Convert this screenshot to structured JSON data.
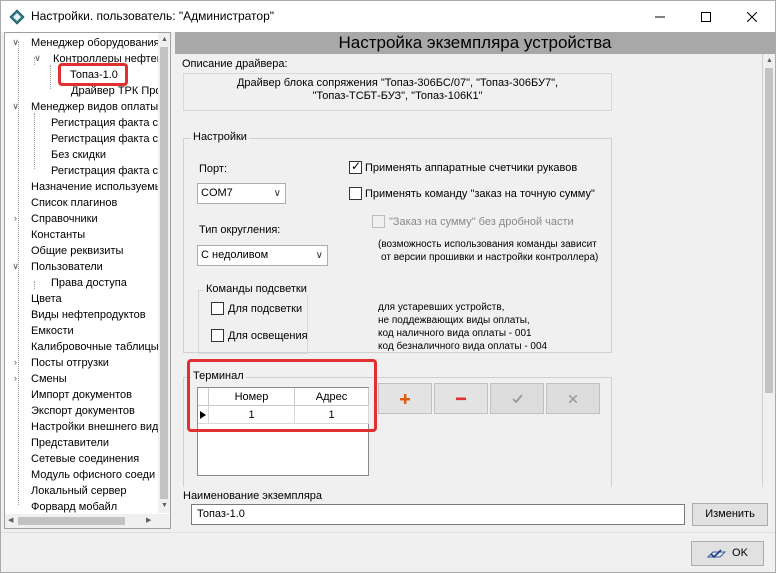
{
  "window": {
    "title": "Настройки. пользователь: \"Администратор\""
  },
  "tree": {
    "items": [
      {
        "label": "Менеджер оборудования"
      },
      {
        "label": "Контроллеры нефтеп"
      },
      {
        "label": "Топаз-1.0"
      },
      {
        "label": "Драйвер ТРК Про"
      },
      {
        "label": "Менеджер видов оплаты"
      },
      {
        "label": "Регистрация факта с"
      },
      {
        "label": "Регистрация факта с"
      },
      {
        "label": "Без скидки"
      },
      {
        "label": "Регистрация факта с"
      },
      {
        "label": "Назначение используемы"
      },
      {
        "label": "Список плагинов"
      },
      {
        "label": "Справочники"
      },
      {
        "label": "Константы"
      },
      {
        "label": "Общие реквизиты"
      },
      {
        "label": "Пользователи"
      },
      {
        "label": "Права доступа"
      },
      {
        "label": "Цвета"
      },
      {
        "label": "Виды нефтепродуктов"
      },
      {
        "label": "Емкости"
      },
      {
        "label": "Калибровочные таблицы"
      },
      {
        "label": "Посты отгрузки"
      },
      {
        "label": "Смены"
      },
      {
        "label": "Импорт документов"
      },
      {
        "label": "Экспорт документов"
      },
      {
        "label": "Настройки внешнего вид"
      },
      {
        "label": "Представители"
      },
      {
        "label": "Сетевые соединения"
      },
      {
        "label": "Модуль офисного соеди"
      },
      {
        "label": "Локальный сервер"
      },
      {
        "label": "Форвард мобайл"
      }
    ]
  },
  "main": {
    "header": "Настройка экземпляра устройства",
    "driver_desc_label": "Описание драйвера:",
    "driver_desc_line1": "Драйвер блока сопряжения \"Топаз-306БС/07\", \"Топаз-306БУ7\",",
    "driver_desc_line2": "\"Топаз-ТСБТ-БУЗ\", \"Топаз-106К1\"",
    "settings": {
      "title": "Настройки",
      "port_label": "Порт:",
      "port_value": "COM7",
      "rounding_label": "Тип округления:",
      "rounding_value": "С недоливом",
      "backlight_group": "Команды подсветки",
      "backlight_fill": "Для подсветки",
      "backlight_light": "Для освещения",
      "hw_counters": "Применять аппаратные счетчики рукавов",
      "exact_sum": "Применять команду \"заказ на точную сумму\"",
      "order_sum_no_fraction": "\"Заказ на сумму\" без дробной части",
      "note1_line1": "(возможность использования команды зависит",
      "note1_line2": "от версии прошивки и настройки контроллера)",
      "note2_line1": "для устаревших устройств,",
      "note2_line2": "не поддежвающих виды оплаты,",
      "note2_line3": "код наличного вида оплаты - 001",
      "note2_line4": "код безналичного вида оплаты - 004"
    },
    "terminal": {
      "title": "Терминал",
      "columns": [
        "Номер",
        "Адрес"
      ],
      "rows": [
        {
          "number": "1",
          "address": "1"
        }
      ]
    },
    "instance": {
      "label": "Наименование экземпляра",
      "value": "Топаз-1.0",
      "rename_button": "Изменить"
    }
  },
  "footer": {
    "ok_button": "OK"
  },
  "colors": {
    "highlight": "#e03030",
    "header_bar": "#a8a8a8",
    "add_icon": "#e05a10",
    "remove_icon": "#e03030"
  }
}
